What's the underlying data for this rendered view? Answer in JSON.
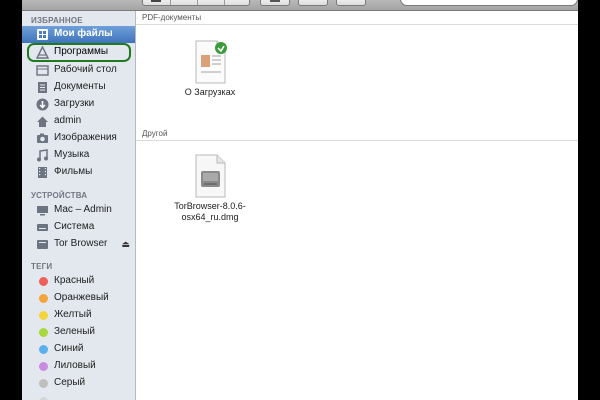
{
  "sidebar": {
    "favorites_header": "ИЗБРАННОЕ",
    "favorites": [
      {
        "label": "Мои файлы",
        "icon": "my-files-icon"
      },
      {
        "label": "Программы",
        "icon": "applications-icon"
      },
      {
        "label": "Рабочий стол",
        "icon": "desktop-icon"
      },
      {
        "label": "Документы",
        "icon": "documents-icon"
      },
      {
        "label": "Загрузки",
        "icon": "downloads-icon"
      },
      {
        "label": "admin",
        "icon": "home-icon"
      },
      {
        "label": "Изображения",
        "icon": "camera-icon"
      },
      {
        "label": "Музыка",
        "icon": "music-note-icon"
      },
      {
        "label": "Фильмы",
        "icon": "film-icon"
      }
    ],
    "devices_header": "УСТРОЙСТВА",
    "devices": [
      {
        "label": "Mac – Admin",
        "icon": "computer-icon"
      },
      {
        "label": "Система",
        "icon": "hard-drive-icon"
      },
      {
        "label": "Tor Browser",
        "icon": "disk-image-icon",
        "eject": "⏏"
      }
    ],
    "tags_header": "ТЕГИ",
    "tags": [
      {
        "label": "Красный",
        "color": "#f0605a"
      },
      {
        "label": "Оранжевый",
        "color": "#f6a33c"
      },
      {
        "label": "Желтый",
        "color": "#f4d63a"
      },
      {
        "label": "Зеленый",
        "color": "#a8d83c"
      },
      {
        "label": "Синий",
        "color": "#5ab0ef"
      },
      {
        "label": "Лиловый",
        "color": "#c98be0"
      },
      {
        "label": "Серый",
        "color": "#bfbfbf"
      }
    ]
  },
  "content": {
    "groups": [
      {
        "title": "PDF-документы",
        "files": [
          {
            "name": "О Загрузках",
            "icon": "pdf-document-icon"
          }
        ]
      },
      {
        "title": "Другой",
        "files": [
          {
            "name_line1": "TorBrowser-8.0.6-",
            "name_line2": "osx64_ru.dmg",
            "icon": "dmg-file-icon"
          }
        ]
      }
    ]
  }
}
